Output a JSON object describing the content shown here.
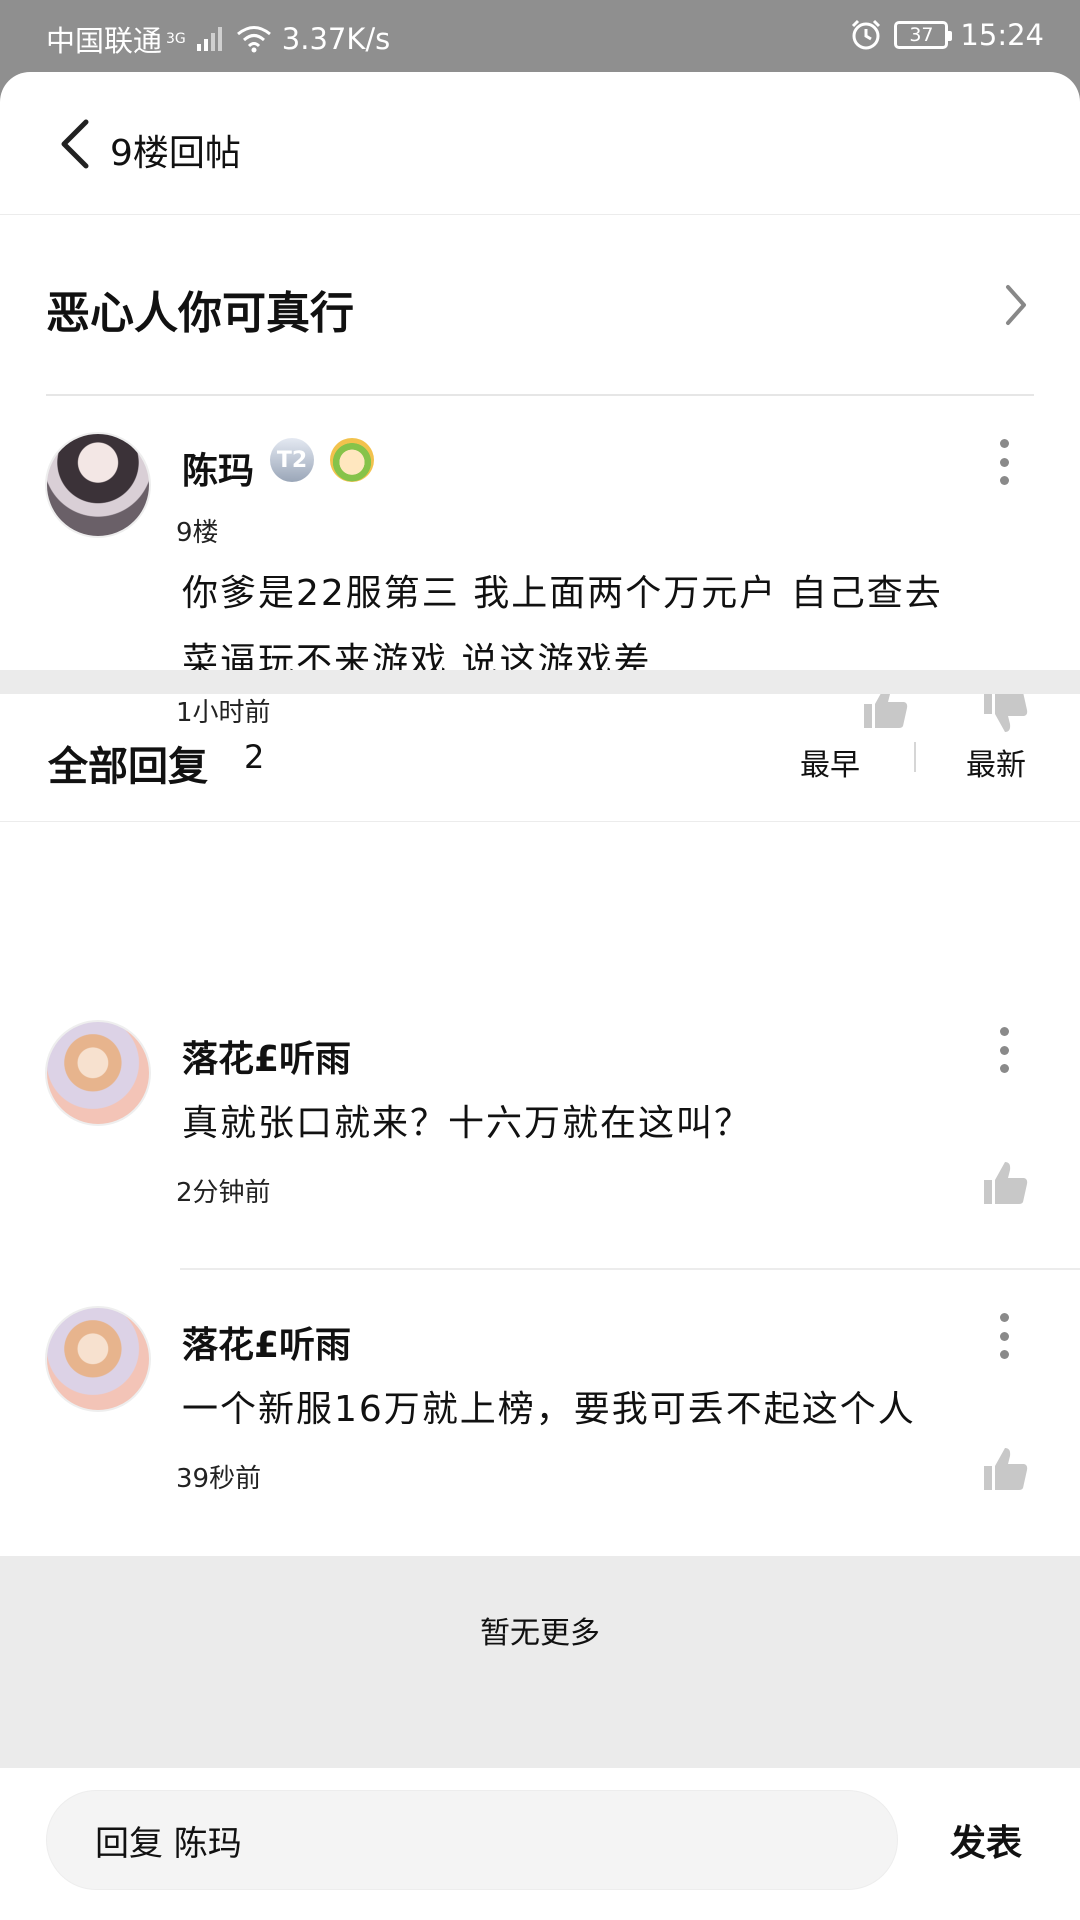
{
  "status_bar": {
    "carrier": "中国联通",
    "network_type": "3G",
    "speed": "3.37K/s",
    "battery": "37",
    "time": "15:24"
  },
  "header": {
    "title": "9楼回帖"
  },
  "thread": {
    "title": "恶心人你可真行"
  },
  "main_post": {
    "author": "陈玛",
    "badge": "T2",
    "floor": "9楼",
    "text_line1": "你爹是22服第三 我上面两个万元户 自己查去",
    "text_line2": "菜逼玩不来游戏 说这游戏差",
    "time": "1小时前"
  },
  "replies_header": {
    "label": "全部回复",
    "count": "2",
    "sort_earliest": "最早",
    "sort_latest": "最新"
  },
  "replies": [
    {
      "author": "落花£听雨",
      "text": "真就张口就来？十六万就在这叫？",
      "time": "2分钟前"
    },
    {
      "author": "落花£听雨",
      "text": "一个新服16万就上榜，要我可丢不起这个人",
      "time": "39秒前"
    }
  ],
  "footer": {
    "no_more": "暂无更多"
  },
  "compose": {
    "placeholder": "回复 陈玛",
    "send_label": "发表"
  },
  "colors": {
    "status_bg": "#8f8f8f",
    "icon_gray": "#b8b8b8",
    "band_gray": "#ebebeb"
  }
}
